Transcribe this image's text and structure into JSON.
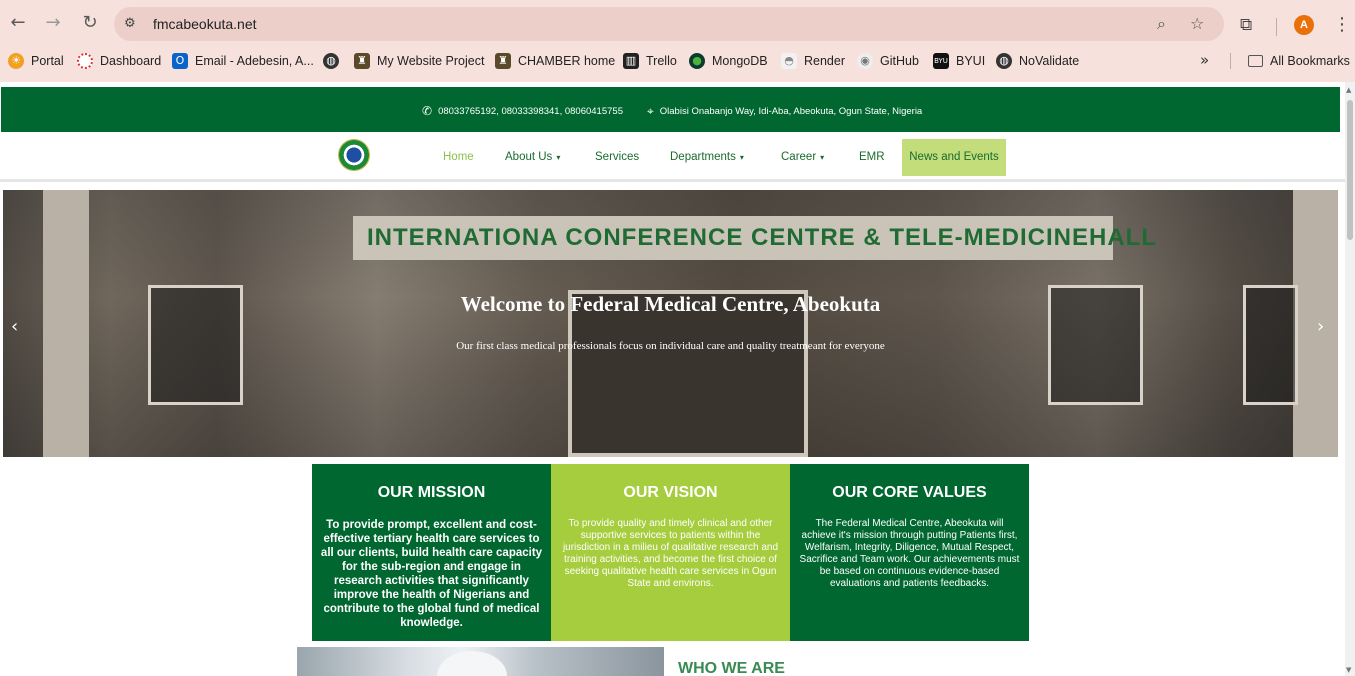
{
  "browser": {
    "url": "fmcabeokuta.net",
    "avatar_letter": "A",
    "bookmarks": [
      {
        "label": "Portal",
        "icon": "portal-icon",
        "color": "#f2a022"
      },
      {
        "label": "Dashboard",
        "icon": "dashboard-icon",
        "color": "#e0312b"
      },
      {
        "label": "Email - Adebesin, A...",
        "icon": "outlook-icon",
        "color": "#0a64c8"
      },
      {
        "label": "",
        "icon": "globe-icon",
        "color": "#333333"
      },
      {
        "label": "My Website Project",
        "icon": "project-icon",
        "color": "#5a4a2a"
      },
      {
        "label": "CHAMBER home",
        "icon": "chamber-icon",
        "color": "#5a4a2a"
      },
      {
        "label": "Trello",
        "icon": "trello-icon",
        "color": "#222222"
      },
      {
        "label": "MongoDB",
        "icon": "mongodb-icon",
        "color": "#0c3b2e"
      },
      {
        "label": "Render",
        "icon": "render-icon",
        "color": "#bbbbbb"
      },
      {
        "label": "GitHub",
        "icon": "github-icon",
        "color": "#dddddd"
      },
      {
        "label": "BYUI",
        "icon": "byui-icon",
        "color": "#111111"
      },
      {
        "label": "NoValidate",
        "icon": "novalidate-icon",
        "color": "#333333"
      }
    ],
    "all_bookmarks": "All Bookmarks"
  },
  "site": {
    "topbar": {
      "phones": "08033765192, 08033398341, 08060415755",
      "address": "Olabisi Onabanjo Way, Idi-Aba, Abeokuta, Ogun State, Nigeria"
    },
    "nav": {
      "home": "Home",
      "about": "About Us",
      "services": "Services",
      "departments": "Departments",
      "career": "Career",
      "emr": "EMR",
      "news": "News and Events"
    },
    "hero": {
      "sign": "INTERNATIONA  CONFERENCE CENTRE & TELE-MEDICINEHALL",
      "title": "Welcome to Federal Medical Centre, Abeokuta",
      "subtitle": "Our first class medical professionals focus on individual care and quality treatmeant for everyone"
    },
    "cards": {
      "mission": {
        "title": "OUR MISSION",
        "text": "To provide prompt, excellent and cost-effective tertiary health care services to all our clients, build health care capacity for the sub-region and engage in research activities that significantly improve the health of Nigerians and contribute to the global fund of medical knowledge."
      },
      "vision": {
        "title": "OUR VISION",
        "text": "To provide quality and timely clinical and other supportive services to patients within the jurisdiction in a milieu of qualitative research and training activities, and become the first choice of seeking qualitative health care services in Ogun State and environs."
      },
      "values": {
        "title": "OUR CORE VALUES",
        "text": "The Federal Medical Centre, Abeokuta will achieve it's mission through putting Patients first, Welfarism, Integrity, Diligence, Mutual Respect, Sacrifice and Team work. Our achievements must be based on continuous evidence-based evaluations and patients feedbacks."
      }
    },
    "who_we_are": "WHO WE ARE"
  },
  "colors": {
    "brand_green": "#016730",
    "lime": "#a6cd3e",
    "nav_highlight": "#c2dd7a"
  }
}
